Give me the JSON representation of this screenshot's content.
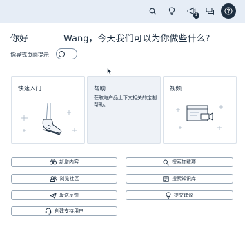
{
  "topbar": {
    "icons": [
      "search-icon",
      "lightbulb-icon",
      "megaphone-icon",
      "chat-icon",
      "help-icon"
    ],
    "notification_count": "1"
  },
  "greeting": {
    "hello": "你好",
    "rest": "Wang，今天我们可以为你做些什么?"
  },
  "guided_tips": {
    "label": "指导式页面提示",
    "enabled": false
  },
  "cards": [
    {
      "title": "快速入门",
      "description": ""
    },
    {
      "title": "帮助",
      "description": "获取与产品上下文相关的定制帮助。"
    },
    {
      "title": "视频",
      "description": ""
    }
  ],
  "actions": {
    "whats_new": "新增内容",
    "search_downloads": "探索加载项",
    "browse_community": "浏览社区",
    "search_kb": "搜索知识库",
    "send_feedback": "发送反馈",
    "submit_idea": "提交建议",
    "create_support_user": "创建支持用户"
  },
  "colors": {
    "topbar_bg": "#e6edf6",
    "text": "#1d2e40",
    "card_border": "#dbe2ea",
    "help_card_bg": "#eef2f7",
    "button_border": "#9aa9b8"
  }
}
